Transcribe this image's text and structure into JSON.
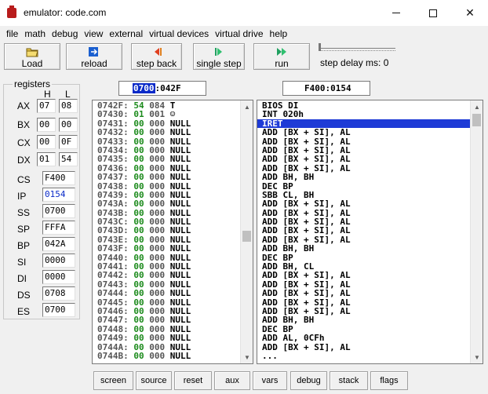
{
  "window": {
    "title": "emulator: code.com"
  },
  "menu": [
    "file",
    "math",
    "debug",
    "view",
    "external",
    "virtual devices",
    "virtual drive",
    "help"
  ],
  "toolbar": {
    "load": "Load",
    "reload": "reload",
    "step_back": "step back",
    "single_step": "single step",
    "run": "run",
    "step_delay": "step delay ms: 0",
    "step_delay_value": 0
  },
  "registers": {
    "legend": "registers",
    "h_label": "H",
    "l_label": "L",
    "AX": {
      "name": "AX",
      "h": "07",
      "l": "08"
    },
    "BX": {
      "name": "BX",
      "h": "00",
      "l": "00"
    },
    "CX": {
      "name": "CX",
      "h": "00",
      "l": "0F"
    },
    "DX": {
      "name": "DX",
      "h": "01",
      "l": "54"
    },
    "CS": {
      "name": "CS",
      "v": "F400"
    },
    "IP": {
      "name": "IP",
      "v": "0154"
    },
    "SS": {
      "name": "SS",
      "v": "0700"
    },
    "SP": {
      "name": "SP",
      "v": "FFFA"
    },
    "BP": {
      "name": "BP",
      "v": "042A"
    },
    "SI": {
      "name": "SI",
      "v": "0000"
    },
    "DI": {
      "name": "DI",
      "v": "0000"
    },
    "DS": {
      "name": "DS",
      "v": "0708"
    },
    "ES": {
      "name": "ES",
      "v": "0700"
    }
  },
  "memory_address": {
    "segment": "0700",
    "offset": ":042F"
  },
  "code_address": "F400:0154",
  "memory": [
    {
      "addr": "0742F:",
      "hex": "54",
      "dec": "084",
      "ch": "T"
    },
    {
      "addr": "07430:",
      "hex": "01",
      "dec": "001",
      "ch": "☺"
    },
    {
      "addr": "07431:",
      "hex": "00",
      "dec": "000",
      "ch": "NULL"
    },
    {
      "addr": "07432:",
      "hex": "00",
      "dec": "000",
      "ch": "NULL"
    },
    {
      "addr": "07433:",
      "hex": "00",
      "dec": "000",
      "ch": "NULL"
    },
    {
      "addr": "07434:",
      "hex": "00",
      "dec": "000",
      "ch": "NULL"
    },
    {
      "addr": "07435:",
      "hex": "00",
      "dec": "000",
      "ch": "NULL"
    },
    {
      "addr": "07436:",
      "hex": "00",
      "dec": "000",
      "ch": "NULL"
    },
    {
      "addr": "07437:",
      "hex": "00",
      "dec": "000",
      "ch": "NULL"
    },
    {
      "addr": "07438:",
      "hex": "00",
      "dec": "000",
      "ch": "NULL"
    },
    {
      "addr": "07439:",
      "hex": "00",
      "dec": "000",
      "ch": "NULL"
    },
    {
      "addr": "0743A:",
      "hex": "00",
      "dec": "000",
      "ch": "NULL"
    },
    {
      "addr": "0743B:",
      "hex": "00",
      "dec": "000",
      "ch": "NULL"
    },
    {
      "addr": "0743C:",
      "hex": "00",
      "dec": "000",
      "ch": "NULL"
    },
    {
      "addr": "0743D:",
      "hex": "00",
      "dec": "000",
      "ch": "NULL"
    },
    {
      "addr": "0743E:",
      "hex": "00",
      "dec": "000",
      "ch": "NULL"
    },
    {
      "addr": "0743F:",
      "hex": "00",
      "dec": "000",
      "ch": "NULL"
    },
    {
      "addr": "07440:",
      "hex": "00",
      "dec": "000",
      "ch": "NULL"
    },
    {
      "addr": "07441:",
      "hex": "00",
      "dec": "000",
      "ch": "NULL"
    },
    {
      "addr": "07442:",
      "hex": "00",
      "dec": "000",
      "ch": "NULL"
    },
    {
      "addr": "07443:",
      "hex": "00",
      "dec": "000",
      "ch": "NULL"
    },
    {
      "addr": "07444:",
      "hex": "00",
      "dec": "000",
      "ch": "NULL"
    },
    {
      "addr": "07445:",
      "hex": "00",
      "dec": "000",
      "ch": "NULL"
    },
    {
      "addr": "07446:",
      "hex": "00",
      "dec": "000",
      "ch": "NULL"
    },
    {
      "addr": "07447:",
      "hex": "00",
      "dec": "000",
      "ch": "NULL"
    },
    {
      "addr": "07448:",
      "hex": "00",
      "dec": "000",
      "ch": "NULL"
    },
    {
      "addr": "07449:",
      "hex": "00",
      "dec": "000",
      "ch": "NULL"
    },
    {
      "addr": "0744A:",
      "hex": "00",
      "dec": "000",
      "ch": "NULL"
    },
    {
      "addr": "0744B:",
      "hex": "00",
      "dec": "000",
      "ch": "NULL"
    }
  ],
  "disassembly": [
    "BIOS DI",
    "INT 020h",
    "IRET",
    "ADD [BX + SI], AL",
    "ADD [BX + SI], AL",
    "ADD [BX + SI], AL",
    "ADD [BX + SI], AL",
    "ADD [BX + SI], AL",
    "ADD BH, BH",
    "DEC BP",
    "SBB CL, BH",
    "ADD [BX + SI], AL",
    "ADD [BX + SI], AL",
    "ADD [BX + SI], AL",
    "ADD [BX + SI], AL",
    "ADD [BX + SI], AL",
    "ADD BH, BH",
    "DEC BP",
    "ADD BH, CL",
    "ADD [BX + SI], AL",
    "ADD [BX + SI], AL",
    "ADD [BX + SI], AL",
    "ADD [BX + SI], AL",
    "ADD [BX + SI], AL",
    "ADD BH, BH",
    "DEC BP",
    "ADD AL, 0CFh",
    "ADD [BX + SI], AL",
    "..."
  ],
  "disassembly_selected_index": 2,
  "bottom_buttons": [
    "screen",
    "source",
    "reset",
    "aux",
    "vars",
    "debug",
    "stack",
    "flags"
  ],
  "colors": {
    "accent": "#0a2ac8",
    "selection": "#1e3bd6",
    "hex_green": "#1b8a1b",
    "title_icon": "#b81c1c"
  }
}
